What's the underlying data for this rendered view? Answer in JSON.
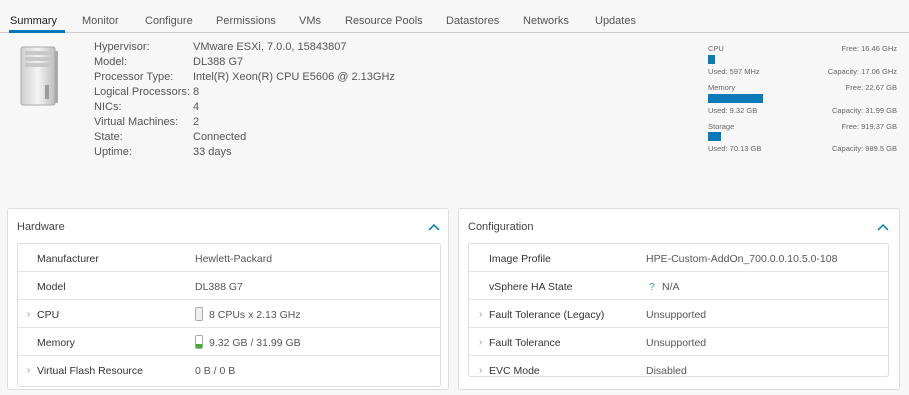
{
  "tabs": [
    "Summary",
    "Monitor",
    "Configure",
    "Permissions",
    "VMs",
    "Resource Pools",
    "Datastores",
    "Networks",
    "Updates"
  ],
  "host": {
    "fields": [
      {
        "label": "Hypervisor:",
        "value": "VMware ESXi, 7.0.0, 15843807"
      },
      {
        "label": "Model:",
        "value": "DL388 G7"
      },
      {
        "label": "Processor Type:",
        "value": "Intel(R) Xeon(R) CPU E5606 @ 2.13GHz"
      },
      {
        "label": "Logical Processors:",
        "value": "8"
      },
      {
        "label": "NICs:",
        "value": "4"
      },
      {
        "label": "Virtual Machines:",
        "value": "2"
      },
      {
        "label": "State:",
        "value": "Connected"
      },
      {
        "label": "Uptime:",
        "value": "33 days"
      }
    ]
  },
  "resources": [
    {
      "name": "CPU",
      "free": "Free: 16.46 GHz",
      "used": "Used: 597 MHz",
      "capacity": "Capacity: 17.06 GHz",
      "fraction": 0.035
    },
    {
      "name": "Memory",
      "free": "Free: 22.67 GB",
      "used": "Used: 9.32 GB",
      "capacity": "Capacity: 31.99 GB",
      "fraction": 0.29
    },
    {
      "name": "Storage",
      "free": "Free: 919.37 GB",
      "used": "Used: 70.13 GB",
      "capacity": "Capacity: 989.5 GB",
      "fraction": 0.071
    }
  ],
  "colors": {
    "accent": "#0079b8",
    "bar": "#0a7ab8"
  },
  "hardware": {
    "title": "Hardware",
    "rows": [
      {
        "label": "Manufacturer",
        "value": "Hewlett-Packard",
        "expandable": false
      },
      {
        "label": "Model",
        "value": "DL388 G7",
        "expandable": false
      },
      {
        "label": "CPU",
        "value": "8 CPUs x 2.13 GHz",
        "expandable": true,
        "icon": "cpu-icon"
      },
      {
        "label": "Memory",
        "value": "9.32 GB / 31.99 GB",
        "expandable": false,
        "icon": "memory-gauge-icon"
      },
      {
        "label": "Virtual Flash Resource",
        "value": "0 B / 0 B",
        "expandable": true
      }
    ]
  },
  "configuration": {
    "title": "Configuration",
    "rows": [
      {
        "label": "Image Profile",
        "value": "HPE-Custom-AddOn_700.0.0.10.5.0-108",
        "expandable": false
      },
      {
        "label": "vSphere HA State",
        "value": "N/A",
        "icon_glyph": "?",
        "expandable": false
      },
      {
        "label": "Fault Tolerance (Legacy)",
        "value": "Unsupported",
        "expandable": true
      },
      {
        "label": "Fault Tolerance",
        "value": "Unsupported",
        "expandable": true
      },
      {
        "label": "EVC Mode",
        "value": "Disabled",
        "expandable": true
      }
    ]
  }
}
